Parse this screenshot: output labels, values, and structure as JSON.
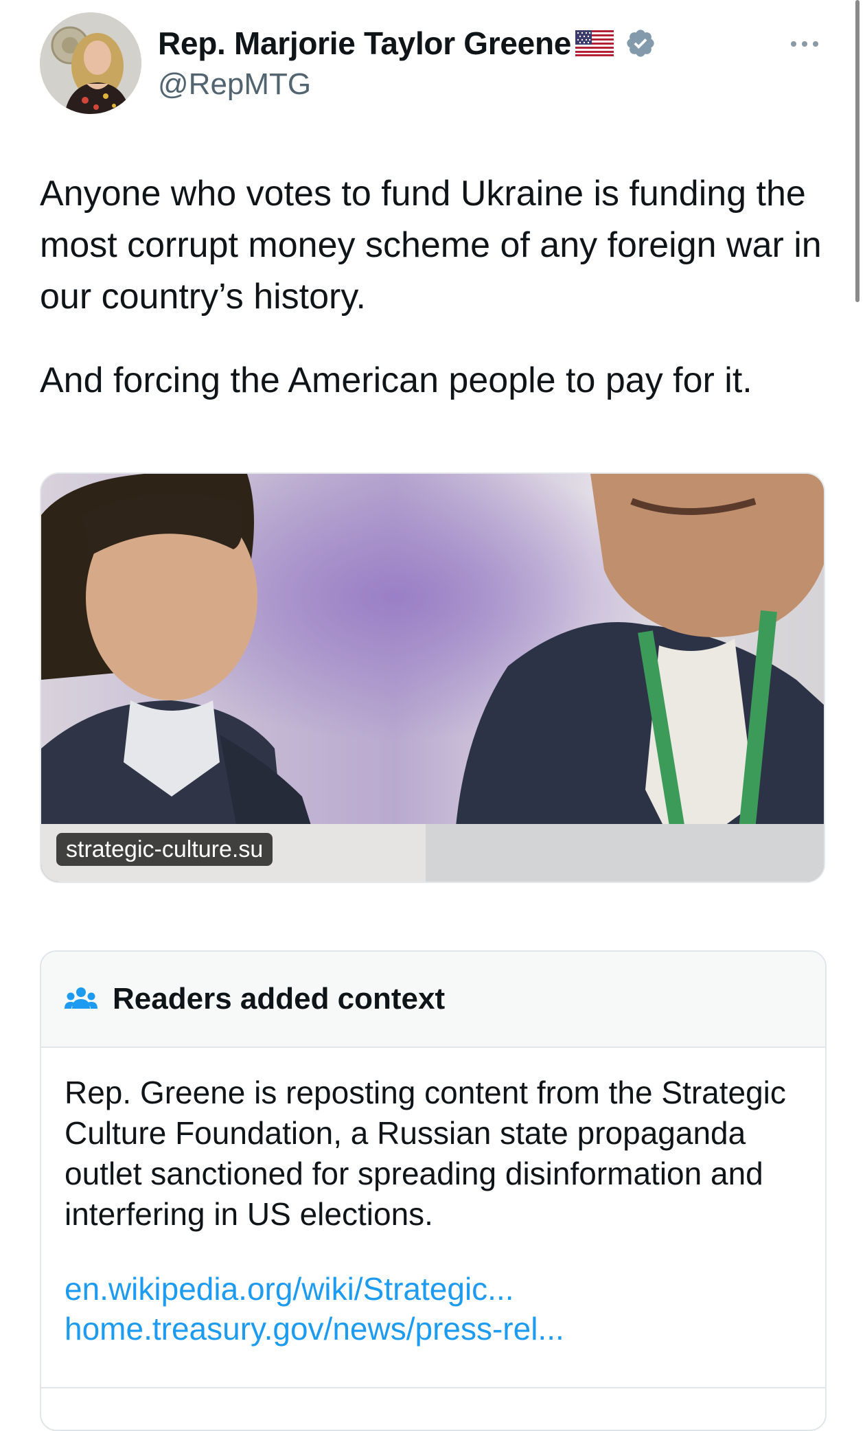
{
  "author": {
    "display_name": "Rep. Marjorie Taylor Greene",
    "handle": "@RepMTG",
    "flag_icon": "us-flag-icon",
    "verified_icon": "verified-badge-icon",
    "verified_color": "#829aab",
    "more_icon": "more-options-icon"
  },
  "tweet": {
    "paragraphs": [
      "Anyone who votes to fund Ukraine is funding the most corrupt money scheme of any foreign war in our country’s history.",
      "And forcing the American people to pay for it."
    ]
  },
  "media": {
    "domain": "strategic-culture.su"
  },
  "community_note": {
    "icon": "people-icon",
    "title": "Readers added context",
    "body": "Rep. Greene is reposting content from the Strategic Culture Foundation, a Russian state propaganda outlet sanctioned for spreading disinformation and interfering in US elections.",
    "links": [
      "en.wikipedia.org/wiki/Strategic...",
      "home.treasury.gov/news/press-rel..."
    ],
    "link_color": "#1d9bf0"
  }
}
